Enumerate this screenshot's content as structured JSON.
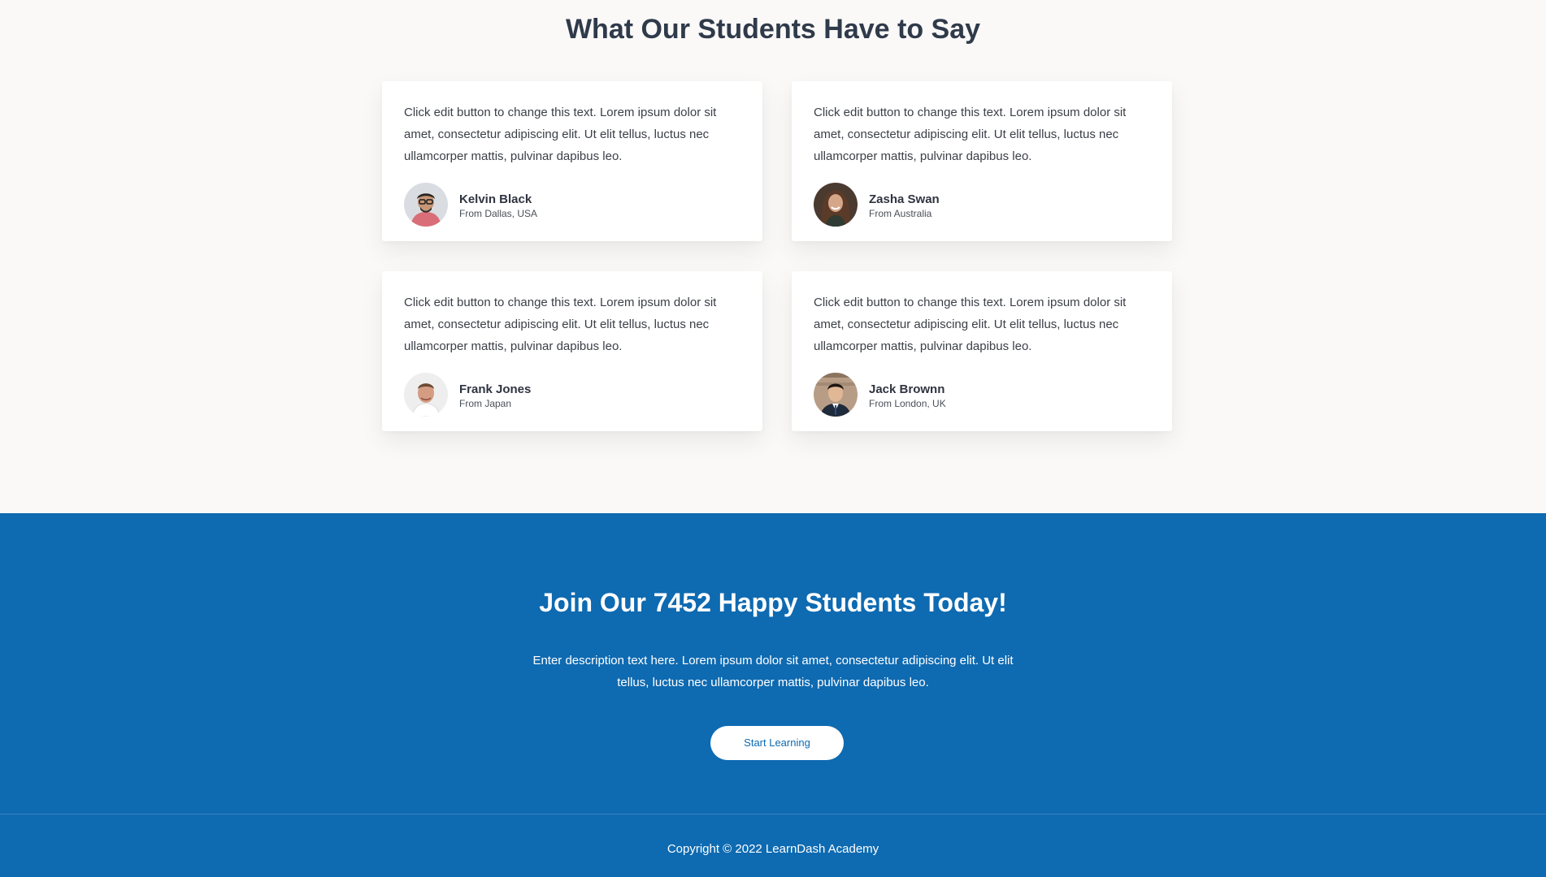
{
  "testimonials": {
    "title": "What Our Students Have to Say",
    "items": [
      {
        "quote": "Click edit button to change this text. Lorem ipsum dolor sit amet, consectetur adipiscing elit. Ut elit tellus, luctus nec ullamcorper mattis, pulvinar dapibus leo.",
        "name": "Kelvin Black",
        "location": "From Dallas, USA"
      },
      {
        "quote": "Click edit button to change this text. Lorem ipsum dolor sit amet, consectetur adipiscing elit. Ut elit tellus, luctus nec ullamcorper mattis, pulvinar dapibus leo.",
        "name": "Zasha Swan",
        "location": "From Australia"
      },
      {
        "quote": "Click edit button to change this text. Lorem ipsum dolor sit amet, consectetur adipiscing elit. Ut elit tellus, luctus nec ullamcorper mattis, pulvinar dapibus leo.",
        "name": "Frank Jones",
        "location": "From Japan"
      },
      {
        "quote": "Click edit button to change this text. Lorem ipsum dolor sit amet, consectetur adipiscing elit. Ut elit tellus, luctus nec ullamcorper mattis, pulvinar dapibus leo.",
        "name": "Jack Brownn",
        "location": "From London, UK"
      }
    ]
  },
  "cta": {
    "title": "Join Our 7452 Happy Students Today!",
    "description": "Enter description text here. Lorem ipsum dolor sit amet, consectetur adipiscing elit. Ut elit tellus, luctus nec ullamcorper mattis, pulvinar dapibus leo.",
    "button_label": "Start Learning"
  },
  "footer": {
    "copyright": "Copyright © 2022 LearnDash Academy"
  },
  "colors": {
    "brand_blue": "#0e6ab1",
    "page_background": "#faf9f8",
    "heading": "#2f3a4a"
  }
}
